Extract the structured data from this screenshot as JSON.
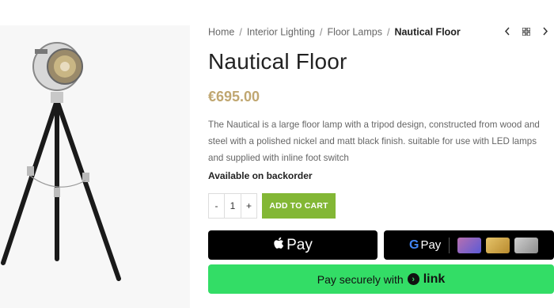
{
  "breadcrumb": {
    "items": [
      "Home",
      "Interior Lighting",
      "Floor Lamps"
    ],
    "separator": "/",
    "current": "Nautical Floor"
  },
  "nav": {
    "prev_icon": "chevron-left-icon",
    "grid_icon": "grid-icon",
    "next_icon": "chevron-right-icon"
  },
  "product": {
    "title": "Nautical Floor",
    "price": "€695.00",
    "description": "The Nautical is a large floor lamp with a tripod design, constructed from wood and steel with a polished nickel and matt black finish. suitable for use with LED lamps and supplied with inline foot switch",
    "availability": "Available on backorder"
  },
  "quantity": {
    "minus": "-",
    "value": "1",
    "plus": "+"
  },
  "buttons": {
    "add_to_cart": "ADD TO CART",
    "apple_pay_label": "Pay",
    "google_pay_label": "Pay",
    "link_pay_text": "Pay securely with",
    "link_word": "link"
  },
  "colors": {
    "price": "#c0a771",
    "add_to_cart": "#83b735",
    "link_green": "#33dd66"
  }
}
